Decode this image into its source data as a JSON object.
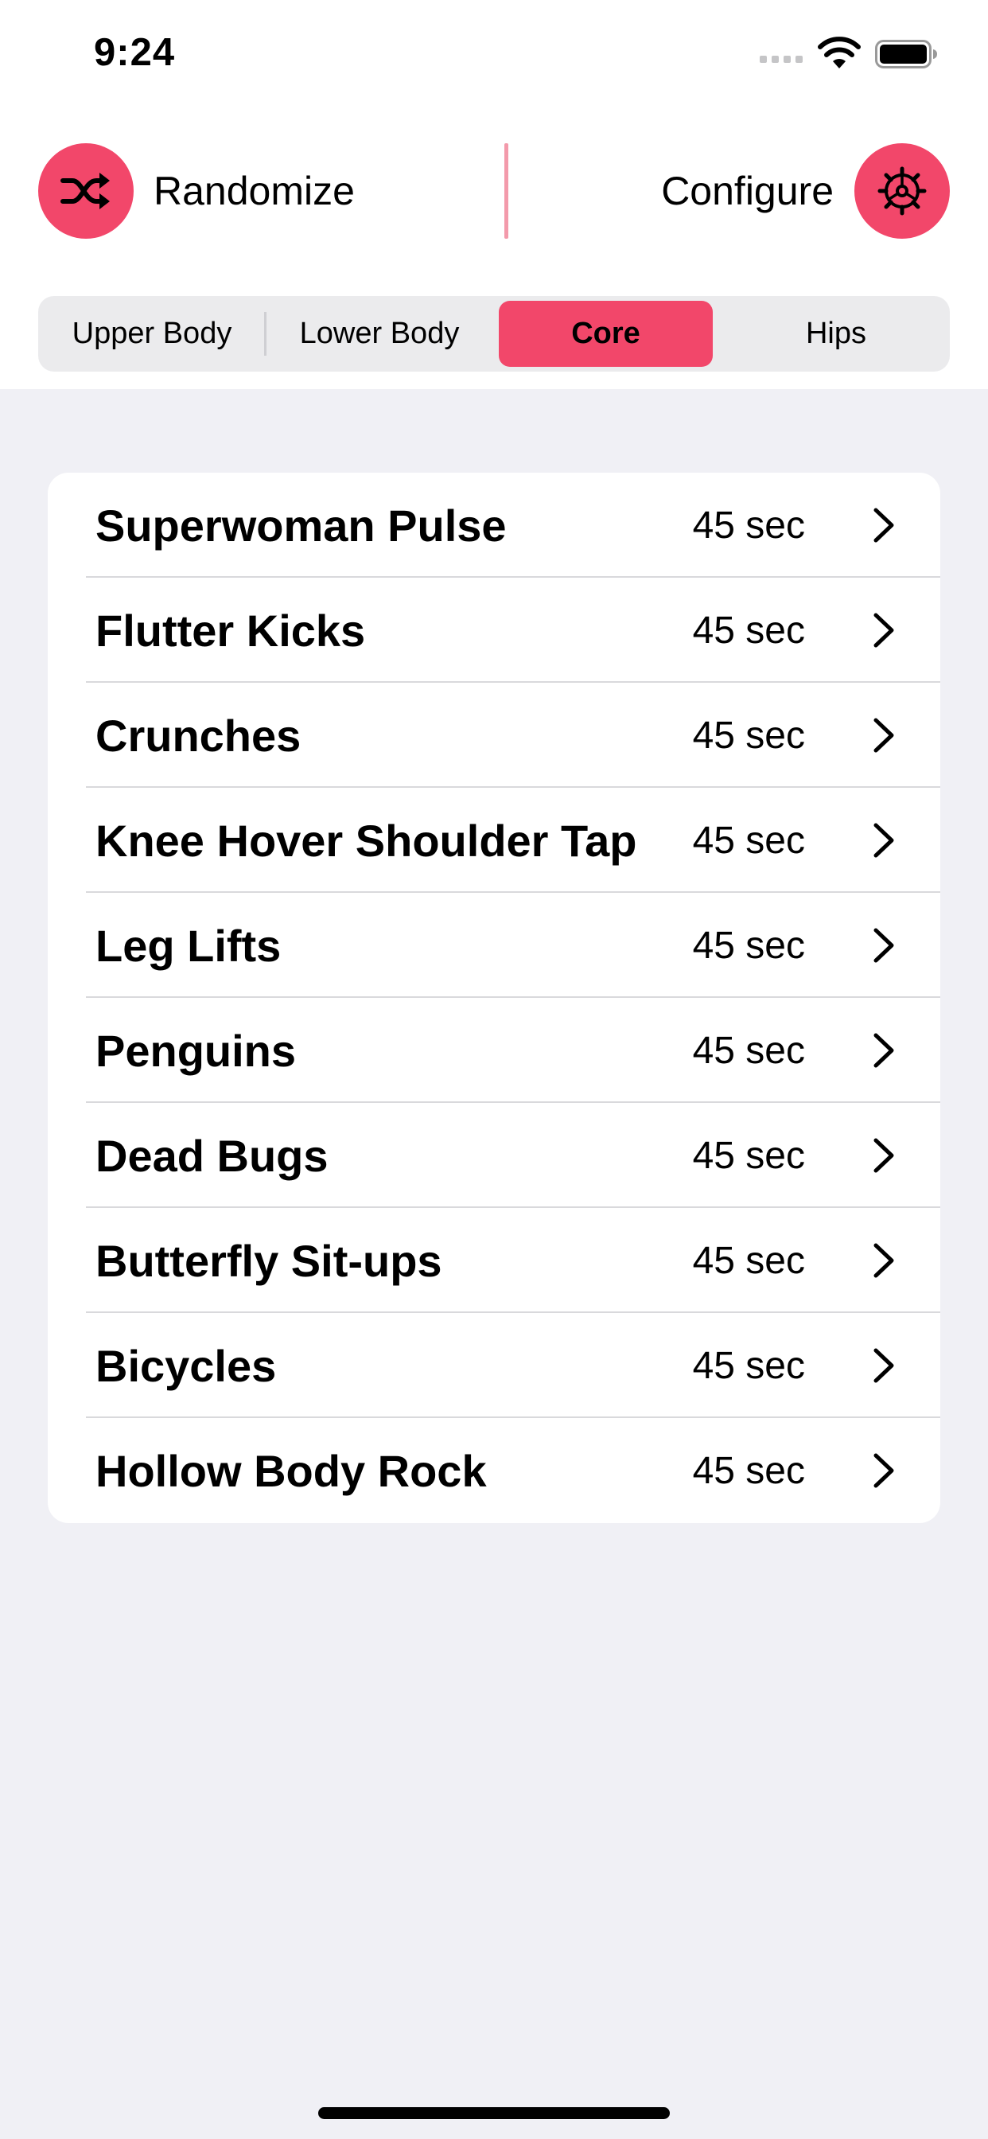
{
  "status_bar": {
    "time": "9:24"
  },
  "header": {
    "randomize_label": "Randomize",
    "randomize_icon": "shuffle-icon",
    "configure_label": "Configure",
    "configure_icon": "gear-icon",
    "accent_color": "#f2476a"
  },
  "tabs": {
    "items": [
      "Upper Body",
      "Lower Body",
      "Core",
      "Hips"
    ],
    "selected": "Core"
  },
  "exercises": [
    {
      "name": "Superwoman Pulse",
      "duration": "45 sec"
    },
    {
      "name": "Flutter Kicks",
      "duration": "45 sec"
    },
    {
      "name": "Crunches",
      "duration": "45 sec"
    },
    {
      "name": "Knee Hover Shoulder Tap",
      "duration": "45 sec"
    },
    {
      "name": "Leg Lifts",
      "duration": "45 sec"
    },
    {
      "name": "Penguins",
      "duration": "45 sec"
    },
    {
      "name": "Dead Bugs",
      "duration": "45 sec"
    },
    {
      "name": "Butterfly Sit-ups",
      "duration": "45 sec"
    },
    {
      "name": "Bicycles",
      "duration": "45 sec"
    },
    {
      "name": "Hollow Body Rock",
      "duration": "45 sec"
    }
  ]
}
